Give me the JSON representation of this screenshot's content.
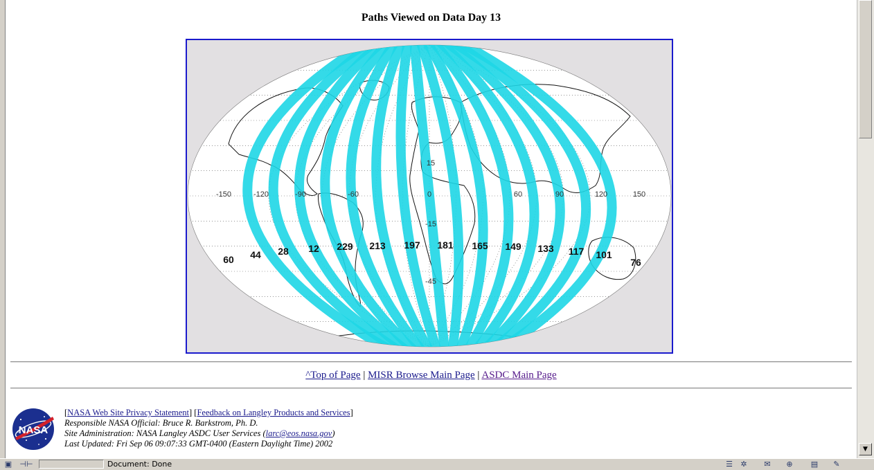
{
  "page": {
    "title": "Paths Viewed on Data Day 13"
  },
  "map": {
    "longitude_labels": [
      "-150",
      "-120",
      "-90",
      "-60",
      "0",
      "60",
      "90",
      "120",
      "150"
    ],
    "latitude_labels": [
      "15",
      "-15",
      "-45"
    ],
    "path_numbers": [
      "60",
      "44",
      "28",
      "12",
      "229",
      "213",
      "197",
      "181",
      "165",
      "149",
      "133",
      "117",
      "101",
      "76"
    ],
    "path_color": "#1ed6e6",
    "background_color": "#e2e0e2",
    "frame_color": "#1a1acc"
  },
  "nav": {
    "top_link": "^Top of Page",
    "misr_link": "MISR Browse Main Page",
    "asdc_link": "ASDC Main Page",
    "separator": "|"
  },
  "footer": {
    "logo_text": "NASA",
    "privacy_link": "NASA Web Site Privacy Statement",
    "feedback_link": "Feedback on Langley Products and Services",
    "official": "Responsible NASA Official: Bruce R. Barkstrom, Ph. D.",
    "admin_prefix": "Site Administration: NASA Langley ASDC User Services (",
    "admin_email": "larc@eos.nasa.gov",
    "admin_suffix": ")",
    "updated": "Last Updated: Fri Sep 06 09:07:33 GMT-0400 (Eastern Daylight Time) 2002"
  },
  "statusbar": {
    "status": "Document: Done"
  }
}
